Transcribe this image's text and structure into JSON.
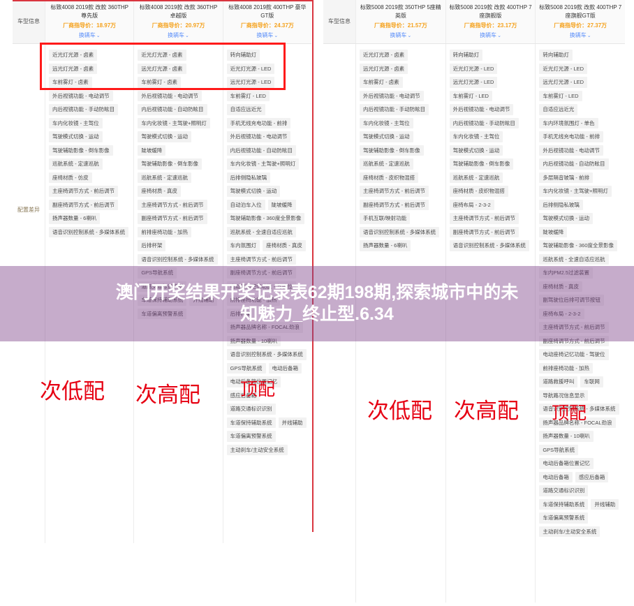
{
  "colors": {
    "price": "#f5a21d",
    "link": "#5b8ff9",
    "highlight_box": "#ff1a1a",
    "divider": "#d9353f",
    "tier_label": "#e60012",
    "overlay": "#80488c",
    "tag_bg": "#f2f2f2"
  },
  "overlay": {
    "line1": "澳门开奖结果开奖记录表62期198期,探索城市中的未",
    "line2": "知魅力_终止型.6.34"
  },
  "tiers": {
    "low": "次低配",
    "mid": "次高配",
    "top": "顶配"
  },
  "labels": {
    "model_info": "车型信息",
    "config_diff": "配置差异",
    "switch_car": "换辆车",
    "chevron": "⌄"
  },
  "left_table": {
    "columns": [
      {
        "name": "标致4008 2019款 改款 360THP 尊先版",
        "price": "厂商指导价：18.97万",
        "link": "换辆车",
        "features": [
          "近光灯光源 - 卤素",
          "远光灯光源 - 卤素",
          "车前雾灯 - 卤素",
          "外后视镜功能 - 电动调节",
          "内后视镜功能 - 手动防眩目",
          "车内化妆镜 - 主驾位",
          "驾驶模式切换 - 运动",
          "驾驶辅助影像 - 倒车影像",
          "巡航系统 - 定速巡航",
          "座椅材质 - 仿皮",
          "主座椅调节方式 - 前后调节",
          "副座椅调节方式 - 前后调节",
          "扬声器数量 - 6喇叭",
          "语音识别控制系统 - 多媒体系统"
        ]
      },
      {
        "name": "标致4008 2019款 改款 360THP 卓越版",
        "price": "厂商指导价：20.97万",
        "link": "换辆车",
        "features": [
          "近光灯光源 - 卤素",
          "远光灯光源 - 卤素",
          "车前雾灯 - 卤素",
          "外后视镜功能 - 电动调节",
          "内后视镜功能 - 自动防眩目",
          "车内化妆镜 - 主驾驶+照明灯",
          "驾驶模式切换 - 运动",
          "陡坡缓降",
          "驾驶辅助影像 - 倒车影像",
          "巡航系统 - 定速巡航",
          "座椅材质 - 真皮",
          "主座椅调节方式 - 前后调节",
          "副座椅调节方式 - 前后调节",
          "前排座椅功能 - 加热",
          "后排杯架",
          "语音识别控制系统 - 多媒体系统",
          "GPS导航系统",
          "道路交通标识识别",
          "车道保持辅助系统",
          "并线辅助",
          "车道偏离预警系统"
        ]
      },
      {
        "name": "标致4008 2019款 400THP 豪华GT版",
        "price": "厂商指导价：24.37万",
        "link": "换辆车",
        "features": [
          "转向辅助灯",
          "近光灯光源 - LED",
          "远光灯光源 - LED",
          "车前雾灯 - LED",
          "自适应远近光",
          "手机无线充电功能 - 前排",
          "外后视镜功能 - 电动调节",
          "内后视镜功能 - 自动防眩目",
          "车内化妆镜 - 主驾驶+照明灯",
          "后排侧隐私玻璃",
          "驾驶模式切换 - 运动",
          "自动泊车入位",
          "陡坡缓降",
          "驾驶辅助影像 - 360度全景影像",
          "巡航系统 - 全速自适应巡航",
          "车内氛围灯",
          "座椅材质 - 真皮",
          "主座椅调节方式 - 前后调节",
          "副座椅调节方式 - 前后调节",
          "电动座椅记忆功能 - 驾驶位",
          "前排座椅功能 - 加热",
          "后排杯架",
          "扬声器品牌名称 - FOCAL劲浪",
          "扬声器数量 - 10喇叭",
          "语音识别控制系统 - 多媒体系统",
          "GPS导航系统",
          "电动后备箱",
          "电动后备箱位置记忆",
          "感应后备箱",
          "道路交通标识识别",
          "车道保持辅助系统",
          "并线辅助",
          "车道偏离预警系统",
          "主动刹车/主动安全系统"
        ]
      }
    ]
  },
  "right_table": {
    "columns": [
      {
        "name": "标致5008 2019款 350THP 5座精英版",
        "price": "厂商指导价：21.57万",
        "link": "换辆车",
        "features": [
          "近光灯光源 - 卤素",
          "远光灯光源 - 卤素",
          "车前雾灯 - 卤素",
          "外后视镜功能 - 电动调节",
          "内后视镜功能 - 手动防眩目",
          "车内化妆镜 - 主驾位",
          "驾驶模式切换 - 运动",
          "驾驶辅助影像 - 倒车影像",
          "巡航系统 - 定速巡航",
          "座椅材质 - 皮织物混搭",
          "主座椅调节方式 - 前后调节",
          "副座椅调节方式 - 前后调节",
          "手机互联/映射功能",
          "语音识别控制系统 - 多媒体系统",
          "扬声器数量 - 6喇叭"
        ]
      },
      {
        "name": "标致5008 2019款 改款 400THP 7座旗舰版",
        "price": "厂商指导价：23.17万",
        "link": "换辆车",
        "features": [
          "转向辅助灯",
          "近光灯光源 - LED",
          "远光灯光源 - LED",
          "车前雾灯 - LED",
          "外后视镜功能 - 电动调节",
          "内后视镜功能 - 手动防眩目",
          "车内化妆镜 - 主驾位",
          "驾驶模式切换 - 运动",
          "驾驶辅助影像 - 倒车影像",
          "巡航系统 - 定速巡航",
          "座椅材质 - 皮织物混搭",
          "座椅布局 - 2-3-2",
          "主座椅调节方式 - 前后调节",
          "副座椅调节方式 - 前后调节",
          "语音识别控制系统 - 多媒体系统"
        ]
      },
      {
        "name": "标致5008 2019款 改款 400THP 7座旗舰GT版",
        "price": "厂商指导价：27.37万",
        "link": "换辆车",
        "features": [
          "转向辅助灯",
          "近光灯光源 - LED",
          "远光灯光源 - LED",
          "车前雾灯 - LED",
          "自适应远近光",
          "车内环境氛围灯 - 单色",
          "手机无线充电功能 - 前排",
          "外后视镜功能 - 电动调节",
          "内后视镜功能 - 自动防眩目",
          "多层隔音玻璃 - 前排",
          "车内化妆镜 - 主驾驶+照明灯",
          "后排侧隐私玻璃",
          "驾驶模式切换 - 运动",
          "陡坡缓降",
          "驾驶辅助影像 - 360度全景影像",
          "巡航系统 - 全速自适应巡航",
          "车内PM2.5过滤装置",
          "座椅材质 - 真皮",
          "副驾驶位后排可调节按钮",
          "座椅布局 - 2-3-2",
          "主座椅调节方式 - 前后调节",
          "副座椅调节方式 - 前后调节",
          "电动座椅记忆功能 - 驾驶位",
          "前排座椅功能 - 加热",
          "道路救援呼叫",
          "车联网",
          "导航路况信息显示",
          "语音识别控制系统 - 多媒体系统",
          "扬声器品牌名称 - FOCAL劲浪",
          "扬声器数量 - 10喇叭",
          "GPS导航系统",
          "电动后备箱位置记忆",
          "电动后备箱",
          "感应后备箱",
          "道路交通标识识别",
          "车道保持辅助系统",
          "并线辅助",
          "车道偏离预警系统",
          "主动刹车/主动安全系统"
        ]
      }
    ]
  }
}
